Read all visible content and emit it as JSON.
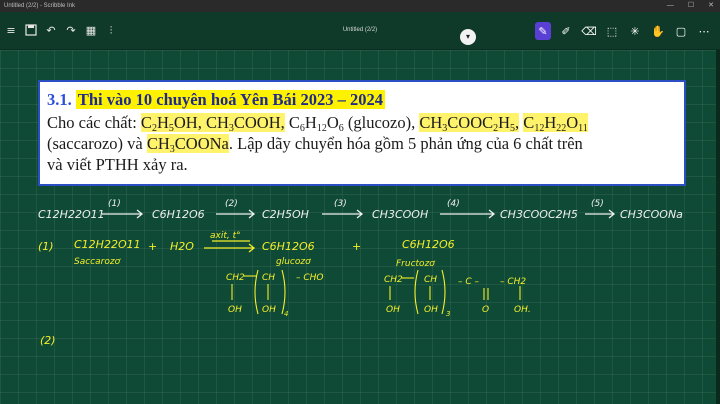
{
  "window": {
    "title": "Untitled (2/2) - Scribble Ink",
    "controls": [
      "—",
      "☐",
      "✕"
    ]
  },
  "toolbar": {
    "document_title": "Untitled (2/2)",
    "left_tools": [
      {
        "icon": "menu-icon",
        "glyph": "≡"
      },
      {
        "icon": "save-icon",
        "glyph": "💾"
      },
      {
        "icon": "undo-icon",
        "glyph": "↶"
      },
      {
        "icon": "redo-icon",
        "glyph": "↷"
      },
      {
        "icon": "grid-icon",
        "glyph": "▦"
      },
      {
        "icon": "sliders-icon",
        "glyph": "⫶"
      }
    ],
    "dropdown_glyph": "▾",
    "right_tools": [
      {
        "icon": "pen-icon",
        "glyph": "✎",
        "active": true
      },
      {
        "icon": "highlighter-icon",
        "glyph": "✐"
      },
      {
        "icon": "eraser-icon",
        "glyph": "⌫"
      },
      {
        "icon": "select-icon",
        "glyph": "⬚"
      },
      {
        "icon": "shapes-icon",
        "glyph": "✳"
      },
      {
        "icon": "hand-icon",
        "glyph": "✋"
      },
      {
        "icon": "page-icon",
        "glyph": "▢"
      },
      {
        "icon": "more-icon",
        "glyph": "⋯"
      }
    ]
  },
  "question": {
    "number": "3.1.",
    "heading": "Thi vào 10 chuyên hoá Yên Bái 2023 – 2024",
    "intro": "Cho các chất: ",
    "compounds": {
      "ethanol": [
        "C",
        "2",
        "H",
        "5",
        "OH"
      ],
      "acetic_acid": "CH",
      "glucose": "(glucozo)",
      "saccarozo_label": "(saccarozo) và ",
      "sodium_acetate": "CH",
      "sodium_acetate_tail": "COONa"
    },
    "line3_text": ". Lập dãy chuyển hóa gồm 5 phản ứng của 6 chất trên",
    "line4_text": "và viết PTHH xảy ra."
  },
  "handwriting": {
    "chain": [
      "C12H22O11",
      "(1)",
      "C6H12O6",
      "(2)",
      "C2H5OH",
      "(3)",
      "CH3COOH",
      "(4)",
      "CH3COOC2H5",
      "(5)",
      "CH3COONa"
    ],
    "step1": {
      "label": "(1)",
      "reactant": "C12H22O11",
      "reactant_name": "Saccarozơ",
      "plus1": "+",
      "water": "H2O",
      "condition": "axit, t°",
      "product1": "C6H12O6",
      "product1_name": "glucozơ",
      "plus2": "+",
      "product2": "C6H12O6",
      "product2_name": "Fructozơ",
      "glucose_structure": [
        "CH2",
        "OH",
        "CH",
        "OH",
        "4",
        "– CHO"
      ],
      "fructose_structure": [
        "CH2",
        "OH",
        "CH",
        "OH",
        "3",
        "– C –",
        "O",
        "– CH2",
        "OH."
      ]
    },
    "step2": {
      "label": "(2)"
    },
    "ink_color": "#f5ef2a"
  }
}
